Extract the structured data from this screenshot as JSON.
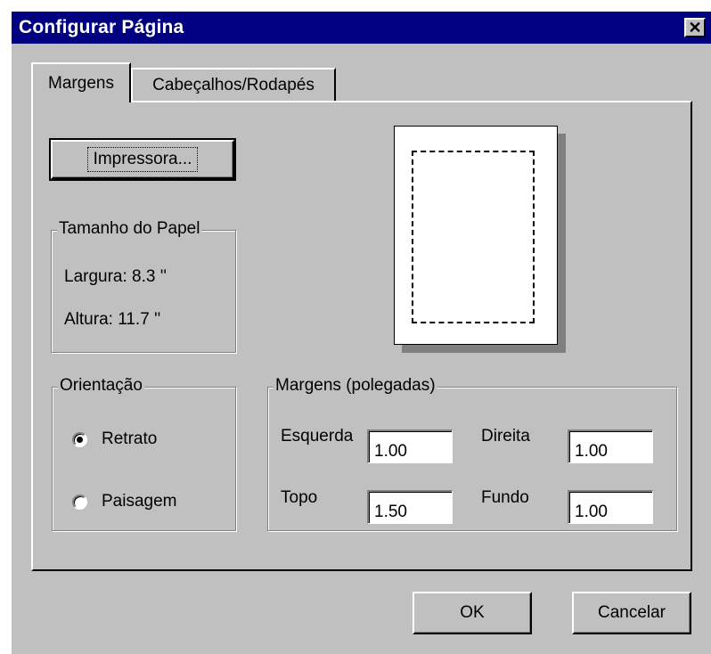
{
  "window": {
    "title": "Configurar Página",
    "close_glyph": "✕"
  },
  "tabs": [
    {
      "label": "Margens",
      "active": true
    },
    {
      "label": "Cabeçalhos/Rodapés",
      "active": false
    }
  ],
  "printer_button": {
    "label": "Impressora..."
  },
  "paper_size": {
    "legend": "Tamanho do Papel",
    "width_label": "Largura: 8.3 ''",
    "height_label": "Altura: 11.7 ''"
  },
  "orientation": {
    "legend": "Orientação",
    "options": [
      {
        "label": "Retrato",
        "selected": true
      },
      {
        "label": "Paisagem",
        "selected": false
      }
    ]
  },
  "margins": {
    "legend": "Margens (polegadas)",
    "left": {
      "label": "Esquerda",
      "value": "1.00"
    },
    "right": {
      "label": "Direita",
      "value": "1.00"
    },
    "top": {
      "label": "Topo",
      "value": "1.50"
    },
    "bottom": {
      "label": "Fundo",
      "value": "1.00"
    }
  },
  "footer": {
    "ok_label": "OK",
    "cancel_label": "Cancelar"
  },
  "colors": {
    "titlebar": "#000080",
    "face": "#c0c0c0"
  },
  "icons": {
    "close": "close-icon",
    "page_preview": "page-preview"
  }
}
